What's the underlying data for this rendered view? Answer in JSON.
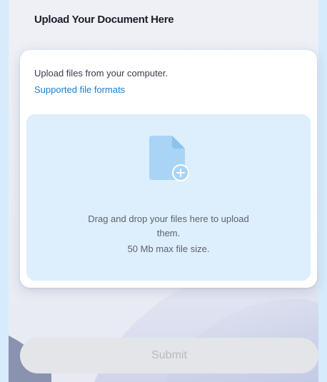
{
  "page": {
    "title": "Upload Your Document Here"
  },
  "upload_card": {
    "intro_text": "Upload files from your computer.",
    "formats_link": "Supported file formats",
    "dropzone": {
      "icon": "file-add-icon",
      "instruction_line1": "Drag and drop your files here to upload",
      "instruction_line2": "them.",
      "max_size": "50 Mb max file size."
    }
  },
  "actions": {
    "submit_label": "Submit",
    "submit_disabled": true
  },
  "colors": {
    "frame_border": "#d6ebfb",
    "panel_background": "#eceef5",
    "dropzone_background": "#ddeefc",
    "file_icon": "#a9d4f5",
    "link": "#1a7fd4",
    "submit_background": "#e4e5e9",
    "submit_text": "#b8bac2"
  }
}
